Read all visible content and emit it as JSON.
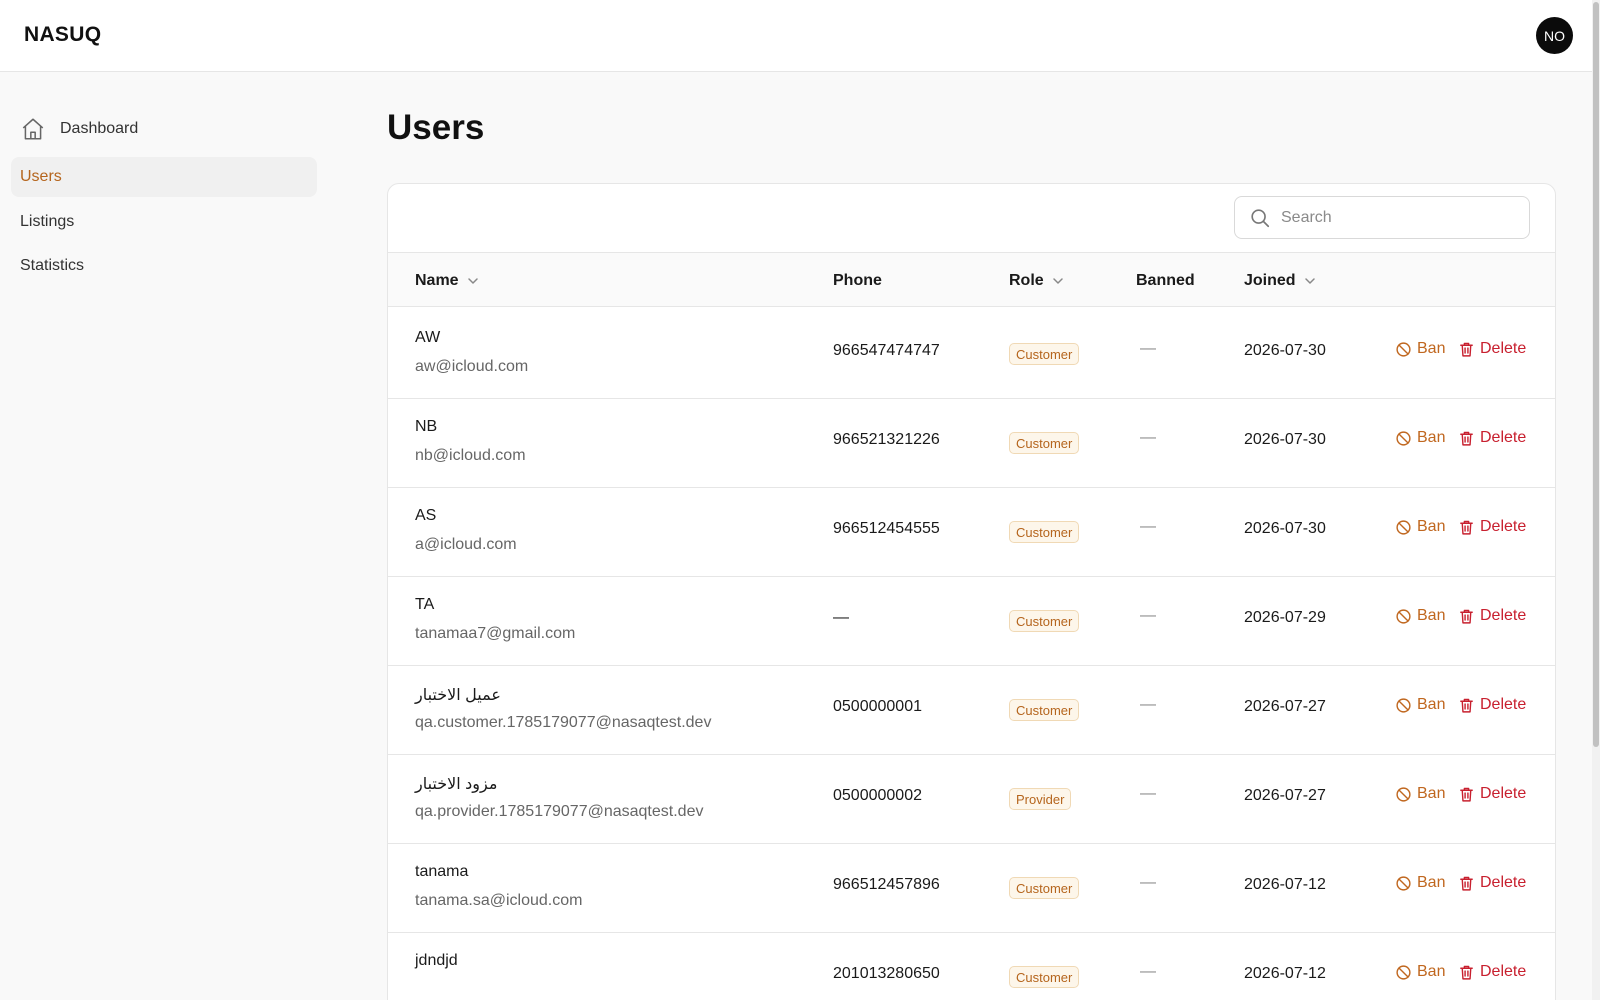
{
  "app": {
    "brand": "NASUQ",
    "avatar_initials": "NO"
  },
  "sidebar": {
    "items": [
      {
        "label": "Dashboard",
        "icon": "home-icon",
        "active": false
      },
      {
        "label": "Users",
        "active": true
      },
      {
        "label": "Listings",
        "active": false
      },
      {
        "label": "Statistics",
        "active": false
      }
    ]
  },
  "page": {
    "title": "Users"
  },
  "search": {
    "placeholder": "Search",
    "value": ""
  },
  "table": {
    "columns": {
      "name": "Name",
      "phone": "Phone",
      "role": "Role",
      "banned": "Banned",
      "joined": "Joined"
    },
    "actions": {
      "ban": "Ban",
      "delete": "Delete"
    },
    "rows": [
      {
        "name": "AW",
        "email": "aw@icloud.com",
        "phone": "966547474747",
        "role": "Customer",
        "banned": "—",
        "joined": "2026-07-30"
      },
      {
        "name": "NB",
        "email": "nb@icloud.com",
        "phone": "966521321226",
        "role": "Customer",
        "banned": "—",
        "joined": "2026-07-30"
      },
      {
        "name": "AS",
        "email": "a@icloud.com",
        "phone": "966512454555",
        "role": "Customer",
        "banned": "—",
        "joined": "2026-07-30"
      },
      {
        "name": "TA",
        "email": "tanamaa7@gmail.com",
        "phone": "—",
        "role": "Customer",
        "banned": "—",
        "joined": "2026-07-29"
      },
      {
        "name": "عميل الاختبار",
        "email": "qa.customer.1785179077@nasaqtest.dev",
        "phone": "0500000001",
        "role": "Customer",
        "banned": "—",
        "joined": "2026-07-27"
      },
      {
        "name": "مزود الاختبار",
        "email": "qa.provider.1785179077@nasaqtest.dev",
        "phone": "0500000002",
        "role": "Provider",
        "banned": "—",
        "joined": "2026-07-27"
      },
      {
        "name": "tanama",
        "email": "tanama.sa@icloud.com",
        "phone": "966512457896",
        "role": "Customer",
        "banned": "—",
        "joined": "2026-07-12"
      },
      {
        "name": "jdndjd",
        "email": "",
        "phone": "201013280650",
        "role": "Customer",
        "banned": "—",
        "joined": "2026-07-12"
      }
    ]
  },
  "colors": {
    "accent": "#b5651d",
    "ban": "#c0671f",
    "delete": "#c8202f",
    "badge_bg": "#fdf6ea",
    "badge_border": "#f0d9b5"
  }
}
